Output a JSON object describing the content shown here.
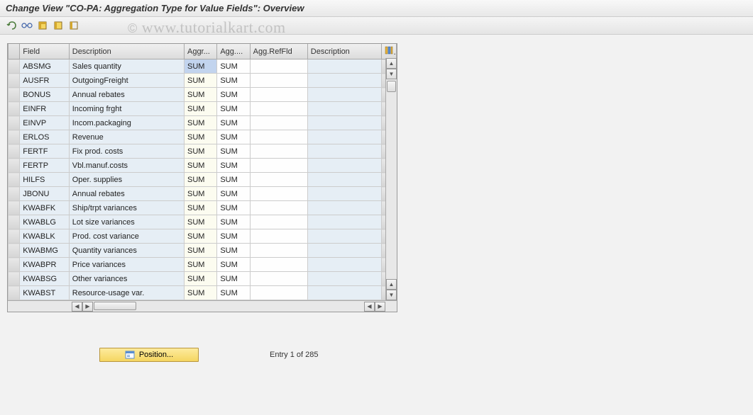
{
  "title": "Change View \"CO-PA: Aggregation Type for Value Fields\": Overview",
  "watermark": "© www.tutorialkart.com",
  "toolbar": {
    "icons": [
      "undo-icon",
      "glasses-icon",
      "select-all-icon",
      "select-block-icon",
      "deselect-icon"
    ]
  },
  "columns": {
    "field": "Field",
    "desc": "Description",
    "aggr1": "Aggr...",
    "aggr2": "Agg....",
    "aggref": "Agg.RefFld",
    "desc2": "Description"
  },
  "rows": [
    {
      "field": "ABSMG",
      "desc": "Sales quantity",
      "a1": "SUM",
      "a2": "SUM",
      "ref": "",
      "d2": ""
    },
    {
      "field": "AUSFR",
      "desc": "OutgoingFreight",
      "a1": "SUM",
      "a2": "SUM",
      "ref": "",
      "d2": ""
    },
    {
      "field": "BONUS",
      "desc": "Annual rebates",
      "a1": "SUM",
      "a2": "SUM",
      "ref": "",
      "d2": ""
    },
    {
      "field": "EINFR",
      "desc": "Incoming frght",
      "a1": "SUM",
      "a2": "SUM",
      "ref": "",
      "d2": ""
    },
    {
      "field": "EINVP",
      "desc": "Incom.packaging",
      "a1": "SUM",
      "a2": "SUM",
      "ref": "",
      "d2": ""
    },
    {
      "field": "ERLOS",
      "desc": "Revenue",
      "a1": "SUM",
      "a2": "SUM",
      "ref": "",
      "d2": ""
    },
    {
      "field": "FERTF",
      "desc": "Fix prod. costs",
      "a1": "SUM",
      "a2": "SUM",
      "ref": "",
      "d2": ""
    },
    {
      "field": "FERTP",
      "desc": "Vbl.manuf.costs",
      "a1": "SUM",
      "a2": "SUM",
      "ref": "",
      "d2": ""
    },
    {
      "field": "HILFS",
      "desc": "Oper. supplies",
      "a1": "SUM",
      "a2": "SUM",
      "ref": "",
      "d2": ""
    },
    {
      "field": "JBONU",
      "desc": "Annual rebates",
      "a1": "SUM",
      "a2": "SUM",
      "ref": "",
      "d2": ""
    },
    {
      "field": "KWABFK",
      "desc": "Ship/trpt variances",
      "a1": "SUM",
      "a2": "SUM",
      "ref": "",
      "d2": ""
    },
    {
      "field": "KWABLG",
      "desc": "Lot size variances",
      "a1": "SUM",
      "a2": "SUM",
      "ref": "",
      "d2": ""
    },
    {
      "field": "KWABLK",
      "desc": "Prod. cost variance",
      "a1": "SUM",
      "a2": "SUM",
      "ref": "",
      "d2": ""
    },
    {
      "field": "KWABMG",
      "desc": "Quantity variances",
      "a1": "SUM",
      "a2": "SUM",
      "ref": "",
      "d2": ""
    },
    {
      "field": "KWABPR",
      "desc": "Price variances",
      "a1": "SUM",
      "a2": "SUM",
      "ref": "",
      "d2": ""
    },
    {
      "field": "KWABSG",
      "desc": "Other variances",
      "a1": "SUM",
      "a2": "SUM",
      "ref": "",
      "d2": ""
    },
    {
      "field": "KWABST",
      "desc": "Resource-usage var.",
      "a1": "SUM",
      "a2": "SUM",
      "ref": "",
      "d2": ""
    }
  ],
  "footer": {
    "position_label": "Position...",
    "entry_label": "Entry 1 of 285"
  }
}
